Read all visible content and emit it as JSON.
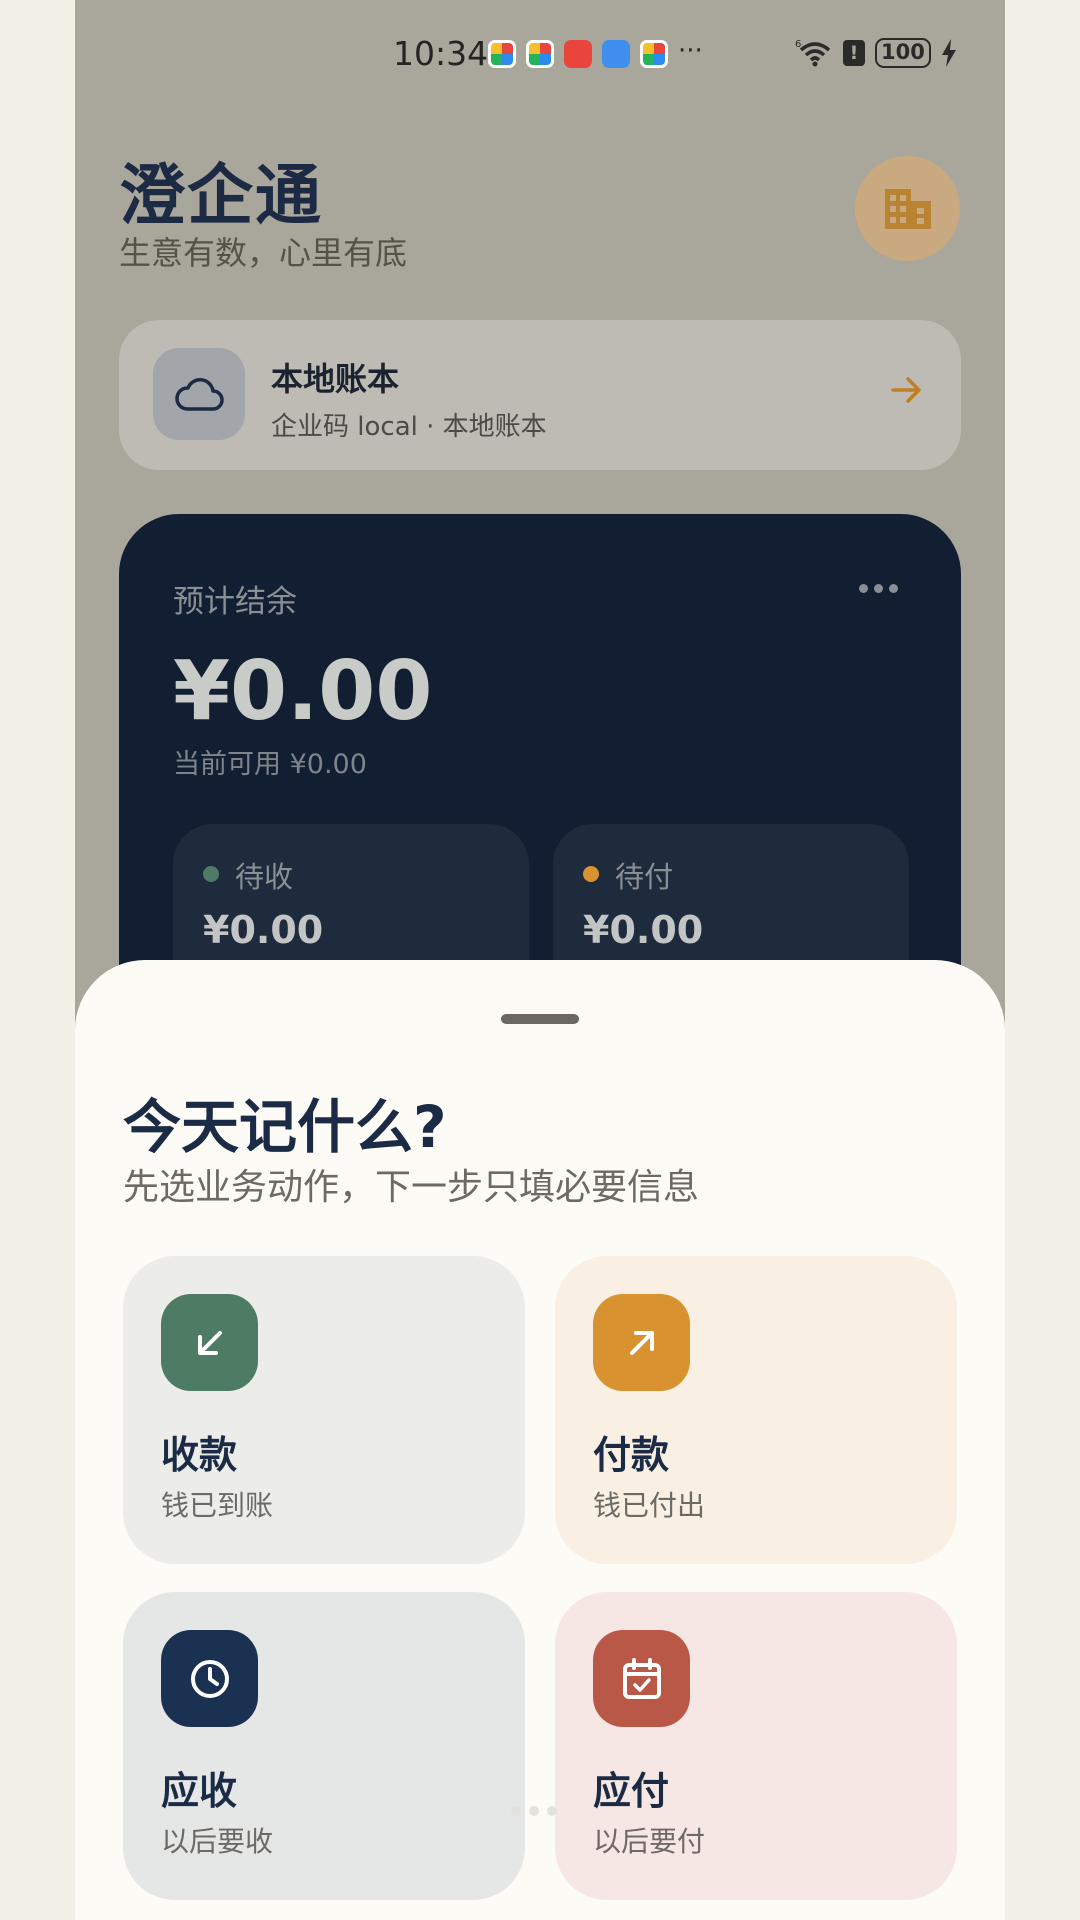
{
  "status_bar": {
    "time": "10:34",
    "more": "···",
    "signal_superscript": "6",
    "battery": "100"
  },
  "header": {
    "title": "澄企通",
    "subtitle": "生意有数，心里有底"
  },
  "ledger": {
    "name": "本地账本",
    "meta": "企业码 local · 本地账本"
  },
  "balance": {
    "label": "预计结余",
    "amount": "¥0.00",
    "available": "当前可用 ¥0.00",
    "receivable_label": "待收",
    "receivable_value": "¥0.00",
    "payable_label": "待付",
    "payable_value": "¥0.00"
  },
  "sheet": {
    "title": "今天记什么?",
    "subtitle": "先选业务动作，下一步只填必要信息",
    "actions": [
      {
        "title": "收款",
        "desc": "钱已到账",
        "icon": "arrow-down-left-icon",
        "bg": "#ecede8",
        "icon_bg": "#4e7b64"
      },
      {
        "title": "付款",
        "desc": "钱已付出",
        "icon": "arrow-up-right-icon",
        "bg": "#f9efe3",
        "icon_bg": "#d8922f"
      },
      {
        "title": "应收",
        "desc": "以后要收",
        "icon": "clock-icon",
        "bg": "#e5e6e6",
        "icon_bg": "#1b3151"
      },
      {
        "title": "应付",
        "desc": "以后要付",
        "icon": "calendar-check-icon",
        "bg": "#f7e7e4",
        "icon_bg": "#ba5847"
      }
    ]
  },
  "colors": {
    "accent": "#d8922f",
    "navy": "#121f33",
    "title": "#1b2b45",
    "receivable_dot": "#4e7b64",
    "payable_dot": "#d8922f"
  }
}
